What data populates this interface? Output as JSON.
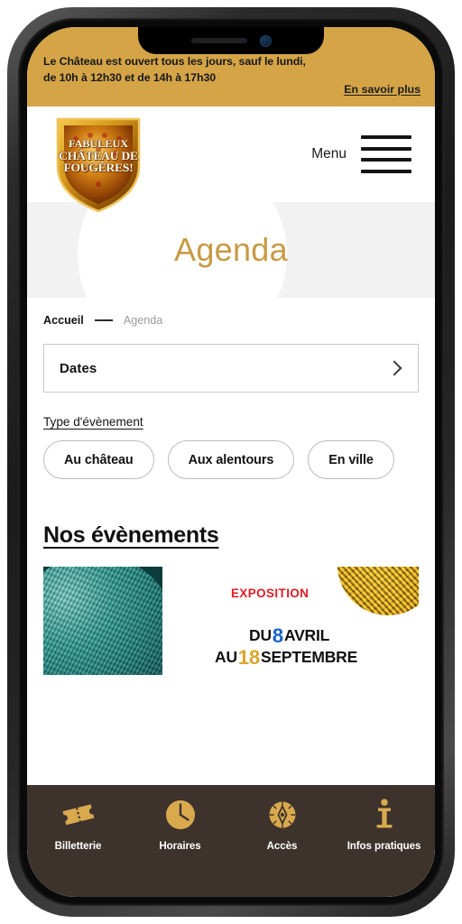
{
  "banner": {
    "text": "Le Château est ouvert tous les jours, sauf le lundi, de 10h à 12h30 et de 14h à 17h30",
    "link_label": "En savoir plus",
    "bg_color": "#d4a447"
  },
  "header": {
    "logo_line1": "FABULEUX",
    "logo_line2": "CHÂTEAU DE",
    "logo_line3": "FOUGÈRES!",
    "menu_label": "Menu"
  },
  "hero": {
    "title": "Agenda",
    "title_color": "#c89a43",
    "band_color": "#f2f2f2"
  },
  "breadcrumb": {
    "home": "Accueil",
    "current": "Agenda"
  },
  "filters": {
    "dates_label": "Dates",
    "type_title": "Type d'évènement",
    "chips": [
      {
        "label": "Au château"
      },
      {
        "label": "Aux alentours"
      },
      {
        "label": "En ville"
      }
    ]
  },
  "events": {
    "section_title": "Nos évènements",
    "card": {
      "kicker": "EXPOSITION",
      "kicker_color": "#e01b24",
      "date_prefix_1": "DU",
      "date_day_1": "8",
      "date_month_1": "AVRIL",
      "date_prefix_2": "AU",
      "date_day_2": "18",
      "date_month_2": "SEPTEMBRE"
    }
  },
  "bottom_nav": {
    "bg_color": "#3d332c",
    "icon_color": "#d9a94e",
    "items": [
      {
        "label": "Billetterie",
        "icon": "ticket-icon"
      },
      {
        "label": "Horaires",
        "icon": "clock-icon"
      },
      {
        "label": "Accès",
        "icon": "compass-icon"
      },
      {
        "label": "Infos pratiques",
        "icon": "info-icon"
      }
    ]
  }
}
